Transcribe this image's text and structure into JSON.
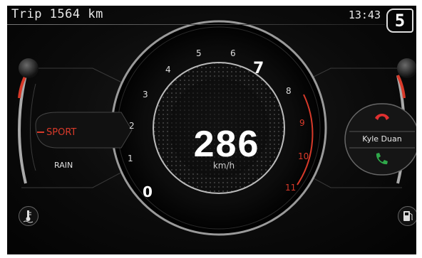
{
  "status": {
    "trip": "Trip 1564 km",
    "clock": "13:43",
    "gear": "5"
  },
  "speedometer": {
    "speed": "286",
    "unit": "km/h",
    "ticks": [
      "0",
      "1",
      "2",
      "3",
      "4",
      "5",
      "6",
      "7",
      "8",
      "9",
      "10",
      "11"
    ]
  },
  "ride_modes": {
    "active": "SPORT",
    "other": "RAIN"
  },
  "call": {
    "caller_name": "Kyle Duan"
  },
  "colors": {
    "accent_red": "#d83a2a",
    "decline": "#e03030",
    "accept": "#2fa84a"
  },
  "icons": {
    "temperature": "coolant-temperature-icon",
    "fuel": "fuel-pump-icon"
  }
}
